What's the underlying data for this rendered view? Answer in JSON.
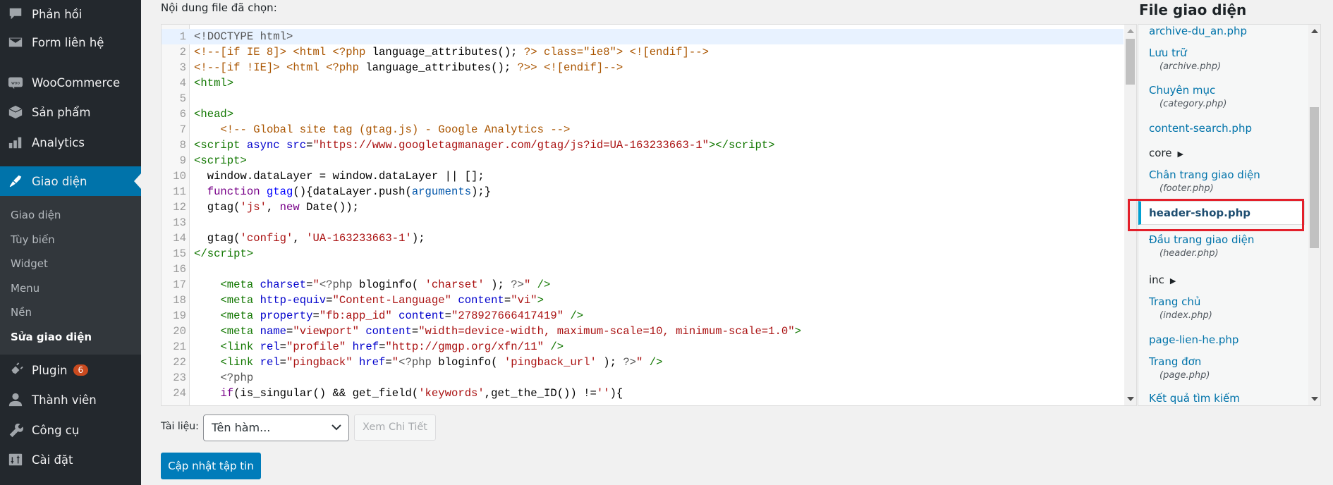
{
  "sidebar": {
    "items": [
      {
        "label": "Phản hồi",
        "icon": "comment-icon"
      },
      {
        "label": "Form liên hệ",
        "icon": "mail-icon"
      },
      {
        "label": "WooCommerce",
        "icon": "woo-icon"
      },
      {
        "label": "Sản phẩm",
        "icon": "box-icon"
      },
      {
        "label": "Analytics",
        "icon": "bar-chart-icon"
      },
      {
        "label": "Giao diện",
        "icon": "paintbrush-icon",
        "active": true
      },
      {
        "label": "Plugin",
        "icon": "plugin-icon",
        "badge": "6"
      },
      {
        "label": "Thành viên",
        "icon": "user-icon"
      },
      {
        "label": "Công cụ",
        "icon": "wrench-icon"
      },
      {
        "label": "Cài đặt",
        "icon": "settings-icon"
      }
    ],
    "submenu": [
      {
        "label": "Giao diện"
      },
      {
        "label": "Tùy biến"
      },
      {
        "label": "Widget"
      },
      {
        "label": "Menu"
      },
      {
        "label": "Nền"
      },
      {
        "label": "Sửa giao diện",
        "current": true
      }
    ],
    "active_color": "#0073aa",
    "badge_color": "#ca4a1f"
  },
  "editor": {
    "label": "Nội dung file đã chọn:",
    "lines": [
      [
        [
          "m",
          "<!DOCTYPE html>"
        ]
      ],
      [
        [
          "c",
          "<!--[if IE 8]> <html <?php "
        ],
        [
          "n",
          "language_attributes();"
        ],
        [
          "c",
          " ?> class=\"ie8\"> <![endif]-->"
        ]
      ],
      [
        [
          "c",
          "<!--[if !IE]> <html <?php "
        ],
        [
          "n",
          "language_attributes();"
        ],
        [
          "c",
          " ?>> <![endif]-->"
        ]
      ],
      [
        [
          "t",
          "<html>"
        ]
      ],
      [],
      [
        [
          "t",
          "<head>"
        ]
      ],
      [
        [
          "n",
          "    "
        ],
        [
          "c",
          "<!-- Global site tag (gtag.js) - Google Analytics -->"
        ]
      ],
      [
        [
          "t",
          "<script"
        ],
        [
          "a",
          " async"
        ],
        [
          "a",
          " src"
        ],
        [
          "n",
          "="
        ],
        [
          "s",
          "\"https://www.googletagmanager.com/gtag/js?id=UA-163233663-1\""
        ],
        [
          "t",
          "></script>"
        ]
      ],
      [
        [
          "t",
          "<script>"
        ]
      ],
      [
        [
          "n",
          "  window.dataLayer = window.dataLayer || [];"
        ]
      ],
      [
        [
          "k",
          "  function"
        ],
        [
          "d",
          " gtag"
        ],
        [
          "n",
          "(){dataLayer.push("
        ],
        [
          "v",
          "arguments"
        ],
        [
          "n",
          ");}"
        ]
      ],
      [
        [
          "n",
          "  gtag("
        ],
        [
          "s",
          "'js'"
        ],
        [
          "n",
          ", "
        ],
        [
          "k",
          "new"
        ],
        [
          "n",
          " Date());"
        ]
      ],
      [],
      [
        [
          "n",
          "  gtag("
        ],
        [
          "s",
          "'config'"
        ],
        [
          "n",
          ", "
        ],
        [
          "s",
          "'UA-163233663-1'"
        ],
        [
          "n",
          ");"
        ]
      ],
      [
        [
          "t",
          "</script>"
        ]
      ],
      [],
      [
        [
          "n",
          "    "
        ],
        [
          "t",
          "<meta"
        ],
        [
          "a",
          " charset"
        ],
        [
          "n",
          "="
        ],
        [
          "s",
          "\""
        ],
        [
          "m",
          "<?php"
        ],
        [
          "n",
          " bloginfo( "
        ],
        [
          "s",
          "'charset'"
        ],
        [
          "n",
          " ); "
        ],
        [
          "m",
          "?>"
        ],
        [
          "s",
          "\""
        ],
        [
          "t",
          " />"
        ]
      ],
      [
        [
          "n",
          "    "
        ],
        [
          "t",
          "<meta"
        ],
        [
          "a",
          " http-equiv"
        ],
        [
          "n",
          "="
        ],
        [
          "s",
          "\"Content-Language\""
        ],
        [
          "a",
          " content"
        ],
        [
          "n",
          "="
        ],
        [
          "s",
          "\"vi\""
        ],
        [
          "t",
          ">"
        ]
      ],
      [
        [
          "n",
          "    "
        ],
        [
          "t",
          "<meta"
        ],
        [
          "a",
          " property"
        ],
        [
          "n",
          "="
        ],
        [
          "s",
          "\"fb:app_id\""
        ],
        [
          "a",
          " content"
        ],
        [
          "n",
          "="
        ],
        [
          "s",
          "\"278927666417419\""
        ],
        [
          "t",
          " />"
        ]
      ],
      [
        [
          "n",
          "    "
        ],
        [
          "t",
          "<meta"
        ],
        [
          "a",
          " name"
        ],
        [
          "n",
          "="
        ],
        [
          "s",
          "\"viewport\""
        ],
        [
          "a",
          " content"
        ],
        [
          "n",
          "="
        ],
        [
          "s",
          "\"width=device-width, maximum-scale=10, minimum-scale=1.0\""
        ],
        [
          "t",
          ">"
        ]
      ],
      [
        [
          "n",
          "    "
        ],
        [
          "t",
          "<link"
        ],
        [
          "a",
          " rel"
        ],
        [
          "n",
          "="
        ],
        [
          "s",
          "\"profile\""
        ],
        [
          "a",
          " href"
        ],
        [
          "n",
          "="
        ],
        [
          "s",
          "\"http://gmgp.org/xfn/11\""
        ],
        [
          "t",
          " />"
        ]
      ],
      [
        [
          "n",
          "    "
        ],
        [
          "t",
          "<link"
        ],
        [
          "a",
          " rel"
        ],
        [
          "n",
          "="
        ],
        [
          "s",
          "\"pingback\""
        ],
        [
          "a",
          " href"
        ],
        [
          "n",
          "="
        ],
        [
          "s",
          "\""
        ],
        [
          "m",
          "<?php"
        ],
        [
          "n",
          " bloginfo( "
        ],
        [
          "s",
          "'pingback_url'"
        ],
        [
          "n",
          " ); "
        ],
        [
          "m",
          "?>"
        ],
        [
          "s",
          "\""
        ],
        [
          "t",
          " />"
        ]
      ],
      [
        [
          "n",
          "    "
        ],
        [
          "m",
          "<?php"
        ]
      ],
      [
        [
          "n",
          "    "
        ],
        [
          "k",
          "if"
        ],
        [
          "n",
          "(is_singular() && get_field("
        ],
        [
          "s",
          "'keywords'"
        ],
        [
          "n",
          ",get_the_ID()) !="
        ],
        [
          "s",
          "''"
        ],
        [
          "n",
          "){"
        ]
      ]
    ]
  },
  "files": {
    "title": "File giao diện",
    "items": [
      {
        "name": "archive-du_an.php"
      },
      {
        "name": "Lưu trữ",
        "sub": "(archive.php)"
      },
      {
        "name": "Chuyên mục",
        "sub": "(category.php)"
      },
      {
        "name": "content-search.php"
      },
      {
        "name": "core",
        "dir": true
      },
      {
        "name": "Chân trang giao diện",
        "sub": "(footer.php)"
      },
      {
        "name": "header-shop.php",
        "current": true
      },
      {
        "name": "Đầu trang giao diện",
        "sub": "(header.php)"
      },
      {
        "name": "inc",
        "dir": true
      },
      {
        "name": "Trang chủ",
        "sub": "(index.php)"
      },
      {
        "name": "page-lien-he.php"
      },
      {
        "name": "Trang đơn",
        "sub": "(page.php)"
      },
      {
        "name": "Kết quả tìm kiếm"
      }
    ],
    "highlight_color": "#e3202b"
  },
  "docs": {
    "label": "Tài liệu:",
    "select_value": "Tên hàm...",
    "view_button": "Xem Chi Tiết"
  },
  "update_button": "Cập nhật tập tin"
}
